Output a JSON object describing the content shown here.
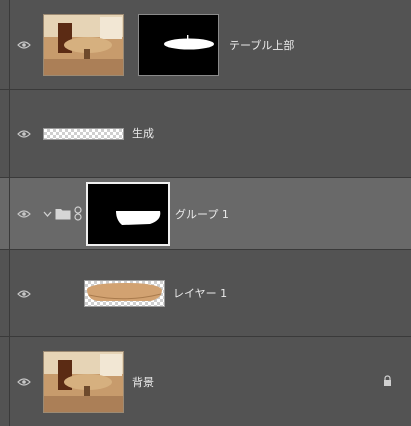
{
  "layers": [
    {
      "name": "テーブル上部",
      "visible": true,
      "type": "mask-layer"
    },
    {
      "name": "生成",
      "visible": true,
      "type": "generated-layer"
    },
    {
      "name": "グループ 1",
      "visible": true,
      "type": "group",
      "expanded": true,
      "selected": true
    },
    {
      "name": "レイヤー 1",
      "visible": true,
      "type": "pixel-layer"
    },
    {
      "name": "背景",
      "visible": true,
      "type": "background",
      "locked": true
    }
  ],
  "icons": {
    "visibility": "eye-icon",
    "expand": "chevron-down-icon",
    "group": "folder-icon",
    "link": "chain-link-icon",
    "lock": "lock-icon"
  },
  "colors": {
    "panel": "#535353",
    "selected_row": "#696969",
    "text": "#eaeaea"
  }
}
